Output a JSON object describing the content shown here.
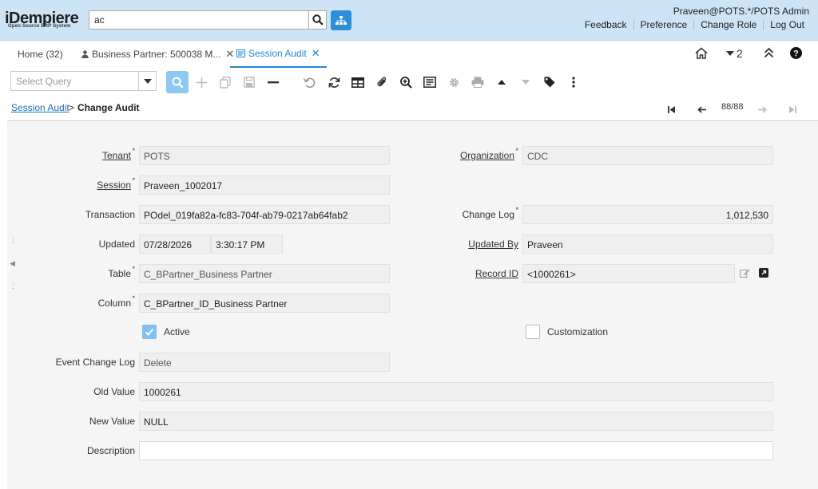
{
  "header": {
    "brand": "iDempiere",
    "brand_sub": "Open Source ERP System",
    "search_value": "ac",
    "user": "Praveen@POTS.*/POTS Admin",
    "links": [
      "Feedback",
      "Preference",
      "Change Role",
      "Log Out"
    ]
  },
  "tabs": [
    {
      "label": "Home (32)"
    },
    {
      "label": "Business Partner: 500038 M..."
    },
    {
      "label": "Session Audit"
    }
  ],
  "tab_tools": {
    "window_count": "2"
  },
  "toolbar": {
    "query_placeholder": "Select Query"
  },
  "breadcrumb": {
    "parent": "Session Audit",
    "separator": ">",
    "current": "Change Audit"
  },
  "navigation": {
    "record_count": "88/88"
  },
  "form": {
    "tenant": {
      "label": "Tenant",
      "value": "POTS"
    },
    "organization": {
      "label": "Organization",
      "value": "CDC"
    },
    "session": {
      "label": "Session",
      "value": "Praveen_1002017"
    },
    "transaction": {
      "label": "Transaction",
      "value": "POdel_019fa82a-fc83-704f-ab79-0217ab64fab2"
    },
    "change_log": {
      "label": "Change Log",
      "value": "1,012,530"
    },
    "updated": {
      "label": "Updated",
      "date": "07/28/2026",
      "time": "3:30:17 PM"
    },
    "updated_by": {
      "label": "Updated By",
      "value": "Praveen"
    },
    "table": {
      "label": "Table",
      "value": "C_BPartner_Business Partner"
    },
    "record_id": {
      "label": "Record ID",
      "value": "<1000261>"
    },
    "column": {
      "label": "Column",
      "value": "C_BPartner_ID_Business Partner"
    },
    "active": {
      "label": "Active",
      "checked": true
    },
    "customization": {
      "label": "Customization",
      "checked": false
    },
    "event_change_log": {
      "label": "Event Change Log",
      "value": "Delete"
    },
    "old_value": {
      "label": "Old Value",
      "value": "1000261"
    },
    "new_value": {
      "label": "New Value",
      "value": "NULL"
    },
    "description": {
      "label": "Description",
      "value": ""
    }
  }
}
